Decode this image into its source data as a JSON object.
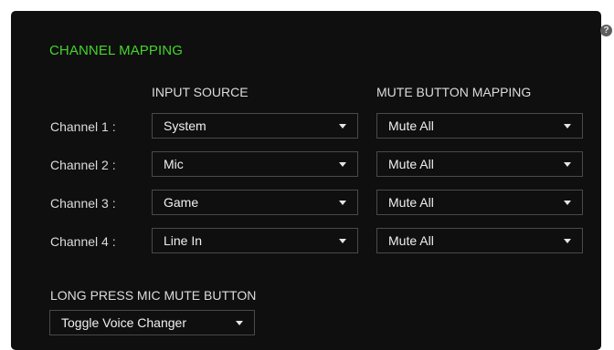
{
  "help": {
    "glyph": "?"
  },
  "title": "CHANNEL MAPPING",
  "headers": {
    "input_source": "INPUT SOURCE",
    "mute_mapping": "MUTE BUTTON MAPPING"
  },
  "channels": [
    {
      "label": "Channel 1 :",
      "input": "System",
      "mute": "Mute All"
    },
    {
      "label": "Channel 2 :",
      "input": "Mic",
      "mute": "Mute All"
    },
    {
      "label": "Channel 3 :",
      "input": "Game",
      "mute": "Mute All"
    },
    {
      "label": "Channel 4 :",
      "input": "Line In",
      "mute": "Mute All"
    }
  ],
  "long_press": {
    "label": "LONG PRESS MIC MUTE BUTTON",
    "value": "Toggle Voice Changer"
  },
  "colors": {
    "accent": "#44d62c",
    "panel_bg": "#0f0f0f",
    "border": "#4a4a4a"
  }
}
